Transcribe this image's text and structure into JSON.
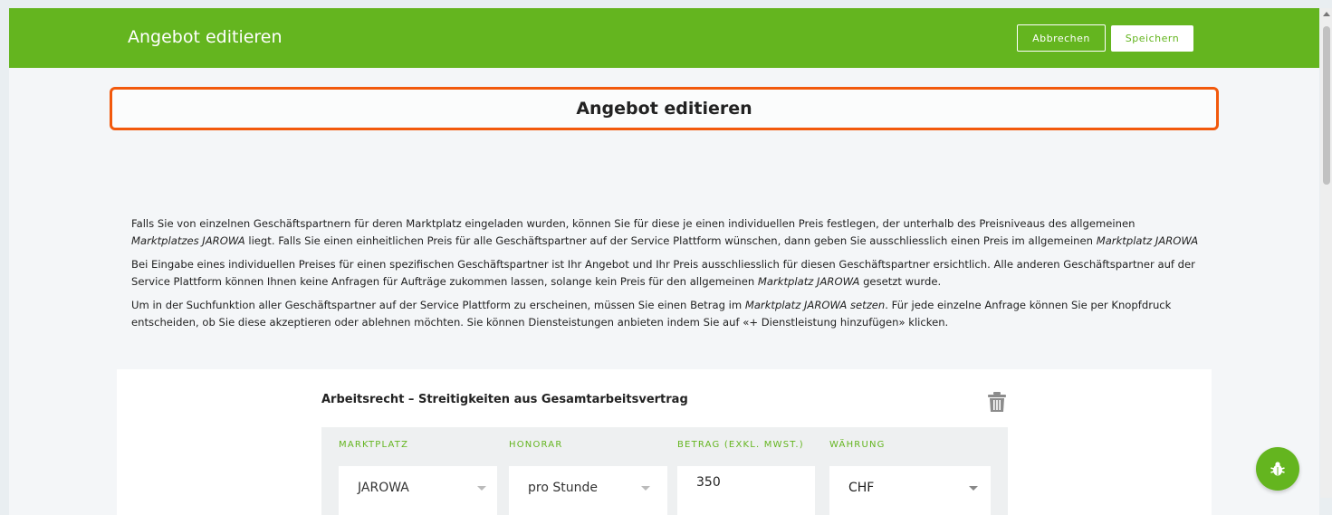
{
  "topbar": {
    "title": "Angebot editieren",
    "cancel_label": "Abbrechen",
    "save_label": "Speichern"
  },
  "heading": "Angebot editieren",
  "intro": {
    "p1_a": "Falls Sie von einzelnen Geschäftspartnern für deren Marktplatz eingeladen wurden, können Sie für diese je einen individuellen Preis festlegen, der unterhalb des Preisniveaus des allgemeinen ",
    "p1_em1": "Marktplatzes JAROWA",
    "p1_b": " liegt. Falls Sie einen einheitlichen Preis für alle Geschäftspartner auf der Service Plattform wünschen, dann geben Sie ausschliesslich einen Preis im allgemeinen ",
    "p1_em2": "Marktplatz JAROWA",
    "p2_a": "Bei Eingabe eines individuellen Preises für einen spezifischen Geschäftspartner ist Ihr Angebot und Ihr Preis ausschliesslich für diesen Geschäftspartner ersichtlich. Alle anderen Geschäftspartner auf der Service Plattform können Ihnen keine Anfragen für Aufträge zukommen lassen, solange kein Preis für den allgemeinen ",
    "p2_em": "Marktplatz JAROWA",
    "p2_b": " gesetzt wurde.",
    "p3_a": "Um in der Suchfunktion aller Geschäftspartner auf der Service Plattform zu erscheinen, müssen Sie einen Betrag im ",
    "p3_em": "Marktplatz JAROWA setzen",
    "p3_b": ". Für jede einzelne Anfrage können Sie per Knopfdruck entscheiden, ob Sie diese akzeptieren oder ablehnen möchten. Sie können Diensteistungen anbieten indem Sie auf «+ Dienstleistung hinzufügen» klicken."
  },
  "service": {
    "title": "Arbeitsrecht – Streitigkeiten aus Gesamtarbeitsvertrag",
    "columns": {
      "marketplace": "MARKTPLATZ",
      "fee": "HONORAR",
      "amount": "BETRAG (EXKL. MWST.)",
      "currency": "WÄHRUNG"
    },
    "row": {
      "marketplace": "JAROWA",
      "fee": "pro Stunde",
      "amount": "350",
      "currency": "CHF"
    }
  },
  "icons": {
    "delete": "trash-icon",
    "bug": "bug-icon"
  },
  "colors": {
    "brand_green": "#64b51f",
    "highlight_orange": "#f2590c"
  }
}
